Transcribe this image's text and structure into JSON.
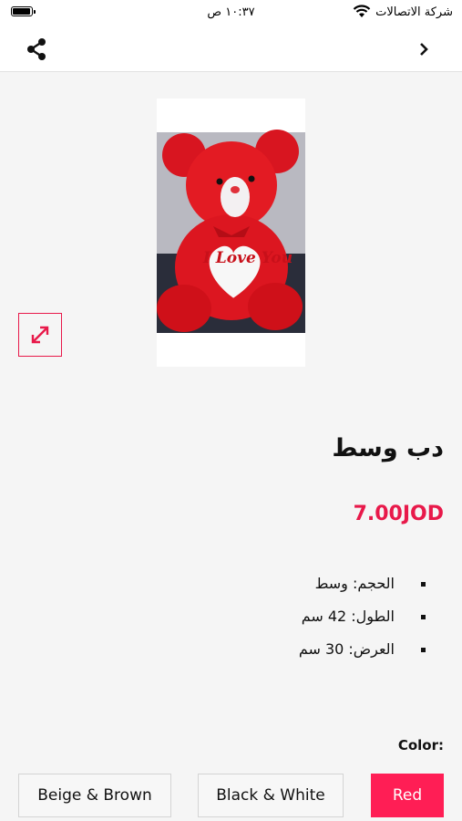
{
  "status_bar": {
    "carrier": "شركة الاتصالات",
    "time": "١٠:٣٧ ص"
  },
  "nav": {
    "share_icon": "share-icon",
    "back_icon": "chevron-right-icon"
  },
  "product": {
    "image_alt": "red teddy bear holding heart",
    "heart_text": "I Love You",
    "title": "دب وسط",
    "price": "7.00JOD",
    "specs": [
      "الحجم: وسط",
      "الطول: 42 سم",
      "العرض: 30 سم"
    ]
  },
  "colors": {
    "label": "Color:",
    "options": [
      "Red",
      "Black & White",
      "Beige & Brown"
    ],
    "selected": "Red"
  },
  "theme": {
    "accent": "#e8194a",
    "selected_bg": "#ff1e55",
    "page_bg": "#f5f5f5"
  }
}
